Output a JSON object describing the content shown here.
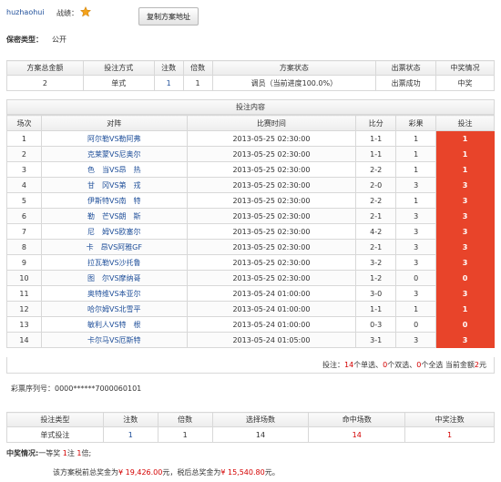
{
  "header": {
    "username": "huzhaohui",
    "record_label": "战绩：",
    "copy_button": "复制方案地址",
    "secrecy_label": "保密类型：",
    "secrecy_value": "公开"
  },
  "summary": {
    "headers": [
      "方案总金额",
      "投注方式",
      "注数",
      "倍数",
      "方案状态",
      "出票状态",
      "中奖情况"
    ],
    "row": [
      "2",
      "单式",
      "1",
      "1",
      "调员（当前进度100.0%）",
      "出票成功",
      "中奖"
    ]
  },
  "bets": {
    "title": "投注内容",
    "headers": [
      "场次",
      "对阵",
      "比赛时间",
      "比分",
      "彩果",
      "投注"
    ],
    "rows": [
      {
        "no": "1",
        "match": "阿尔勒VS勒阿弗",
        "time": "2013-05-25 02:30:00",
        "score": "1-1",
        "result": "1",
        "bet": "1"
      },
      {
        "no": "2",
        "match": "克莱蒙VS尼奥尔",
        "time": "2013-05-25 02:30:00",
        "score": "1-1",
        "result": "1",
        "bet": "1"
      },
      {
        "no": "3",
        "match": "色　当VS昂　热",
        "time": "2013-05-25 02:30:00",
        "score": "2-2",
        "result": "1",
        "bet": "1"
      },
      {
        "no": "4",
        "match": "甘　冈VS第　戎",
        "time": "2013-05-25 02:30:00",
        "score": "2-0",
        "result": "3",
        "bet": "3"
      },
      {
        "no": "5",
        "match": "伊斯特VS南　特",
        "time": "2013-05-25 02:30:00",
        "score": "2-2",
        "result": "1",
        "bet": "3"
      },
      {
        "no": "6",
        "match": "勒　芒VS朗　斯",
        "time": "2013-05-25 02:30:00",
        "score": "2-1",
        "result": "3",
        "bet": "3"
      },
      {
        "no": "7",
        "match": "尼　姆VS欧塞尔",
        "time": "2013-05-25 02:30:00",
        "score": "4-2",
        "result": "3",
        "bet": "3"
      },
      {
        "no": "8",
        "match": "卡　昂VS阿雅GF",
        "time": "2013-05-25 02:30:00",
        "score": "2-1",
        "result": "3",
        "bet": "3"
      },
      {
        "no": "9",
        "match": "拉瓦勒VS沙托鲁",
        "time": "2013-05-25 02:30:00",
        "score": "3-2",
        "result": "3",
        "bet": "3"
      },
      {
        "no": "10",
        "match": "图　尔VS摩纳哥",
        "time": "2013-05-25 02:30:00",
        "score": "1-2",
        "result": "0",
        "bet": "0"
      },
      {
        "no": "11",
        "match": "奥特维VS本亚尔",
        "time": "2013-05-24 01:00:00",
        "score": "3-0",
        "result": "3",
        "bet": "3"
      },
      {
        "no": "12",
        "match": "哈尔姆VS北雪平",
        "time": "2013-05-24 01:00:00",
        "score": "1-1",
        "result": "1",
        "bet": "1"
      },
      {
        "no": "13",
        "match": "敏利人VS特　根",
        "time": "2013-05-24 01:00:00",
        "score": "0-3",
        "result": "0",
        "bet": "0"
      },
      {
        "no": "14",
        "match": "卡尔马VS厄斯特",
        "time": "2013-05-24 01:05:00",
        "score": "3-1",
        "result": "3",
        "bet": "3"
      }
    ],
    "footer": {
      "prefix": "投注：",
      "single_count": "14",
      "single_label": "个单选、",
      "double_count": "0",
      "double_label": "个双选、",
      "full_count": "0",
      "full_label": "个全选 当前金额",
      "amount": "2",
      "unit": "元"
    }
  },
  "serial": {
    "label": "彩票序列号：",
    "value": "0000******7000060101"
  },
  "prize_table": {
    "headers": [
      "投注类型",
      "注数",
      "倍数",
      "选择场数",
      "命中场数",
      "中奖注数"
    ],
    "row": [
      "单式投注",
      "1",
      "1",
      "14",
      "14",
      "1"
    ]
  },
  "prize": {
    "label": "中奖情况:",
    "tier": "一等奖",
    "count": "1",
    "count_unit": "注",
    "multiple": "1",
    "multiple_unit": "倍;",
    "pretax_text": "该方案税前总奖金为",
    "pretax_amount": "¥ 19,426.00",
    "mid_text": "元，税后总奖金为",
    "posttax_amount": "¥ 15,540.80",
    "end_text": "元。"
  },
  "colors": {
    "bet_cell": "#e8442a",
    "link_blue": "#1f4f9a",
    "highlight_red": "#d40000"
  }
}
